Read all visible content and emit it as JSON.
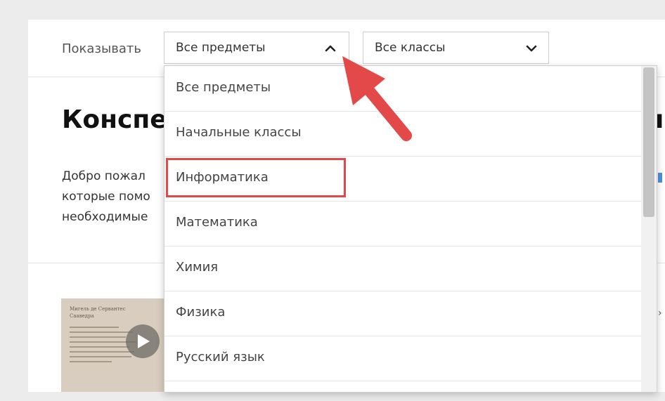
{
  "filter": {
    "show_label": "Показывать",
    "subject_selected": "Все предметы",
    "class_selected": "Все классы"
  },
  "page": {
    "heading": "Конспе",
    "heading_right": "ı",
    "intro_lines": [
      "Добро пожал",
      "которые помо",
      "необходимые"
    ]
  },
  "thumbnail": {
    "title": "Мигель де Сервантес Сааведра",
    "right_icon_text": "›"
  },
  "dropdown": {
    "items": [
      "Все предметы",
      "Начальные классы",
      "Информатика",
      "Математика",
      "Химия",
      "Физика",
      "Русский язык"
    ],
    "highlighted_item": "Информатика"
  },
  "colors": {
    "highlight_border": "#e34948",
    "arrow": "#e34948",
    "link_accent": "#4a90d9"
  },
  "icons": {
    "subject_chevron": "chevron-up-icon",
    "class_chevron": "chevron-down-icon",
    "play": "play-icon",
    "annotation_arrow": "red-arrow-icon"
  }
}
